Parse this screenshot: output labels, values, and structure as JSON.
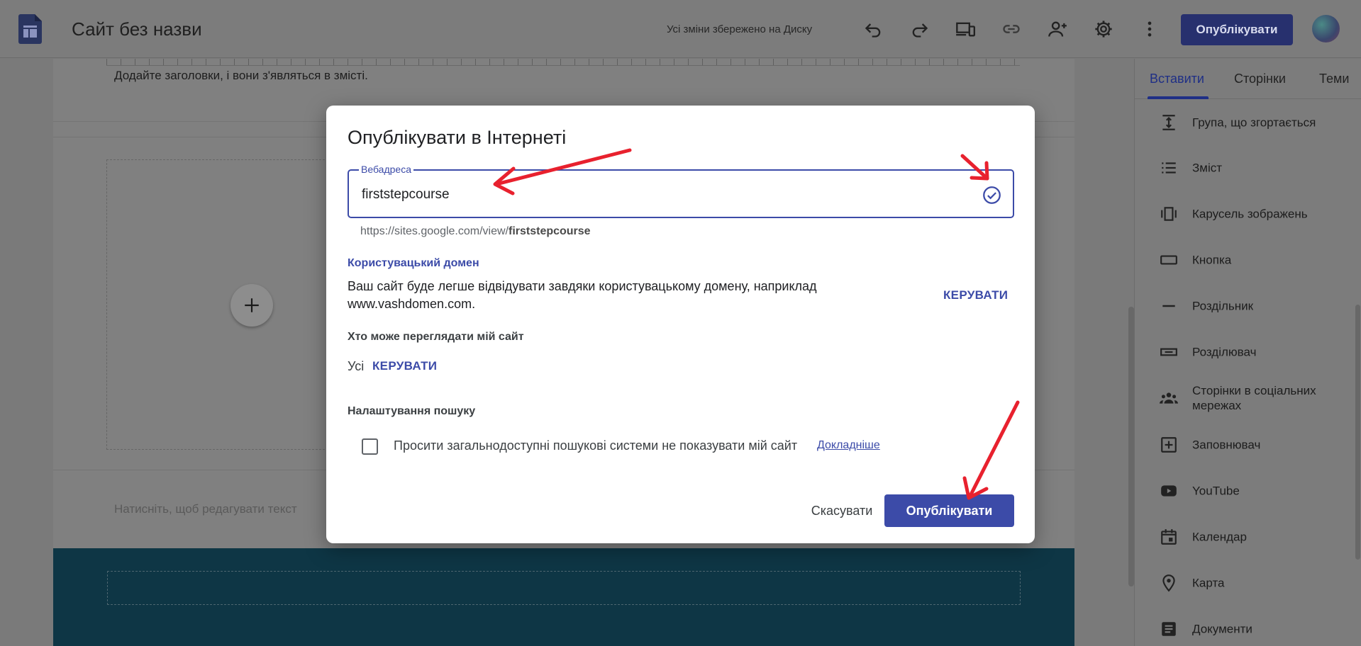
{
  "header": {
    "site_title": "Сайт без назви",
    "save_status": "Усі зміни збережено на Диску",
    "publish_label": "Опублікувати"
  },
  "editor": {
    "toc_hint": "Додайте заголовки, і вони з'являться в змісті.",
    "click_hint": "Натисніть, щоб редагувати текст"
  },
  "panel": {
    "tabs": [
      {
        "label": "Вставити",
        "active": true
      },
      {
        "label": "Сторінки",
        "active": false
      },
      {
        "label": "Теми",
        "active": false
      }
    ],
    "items": [
      {
        "label": "Група, що згортається",
        "icon": "collapsible-group-icon"
      },
      {
        "label": "Зміст",
        "icon": "table-of-contents-icon"
      },
      {
        "label": "Карусель зображень",
        "icon": "carousel-icon"
      },
      {
        "label": "Кнопка",
        "icon": "button-icon"
      },
      {
        "label": "Роздільник",
        "icon": "divider-icon"
      },
      {
        "label": "Розділювач",
        "icon": "spacer-icon"
      },
      {
        "label": "Сторінки в соціальних мережах",
        "icon": "social-links-icon"
      },
      {
        "label": "Заповнювач",
        "icon": "placeholder-icon"
      },
      {
        "label": "YouTube",
        "icon": "youtube-icon"
      },
      {
        "label": "Календар",
        "icon": "calendar-icon"
      },
      {
        "label": "Карта",
        "icon": "map-pin-icon"
      },
      {
        "label": "Документи",
        "icon": "docs-icon"
      }
    ]
  },
  "dialog": {
    "title": "Опублікувати в Інтернеті",
    "field_label": "Вебадреса",
    "field_value": "firststepcourse",
    "url_prefix": "https://sites.google.com/view/",
    "url_slug": "firststepcourse",
    "custom_domain_heading": "Користувацький домен",
    "custom_domain_desc": "Ваш сайт буде легше відвідувати завдяки користувацькому домену, наприклад www.vashdomen.com.",
    "manage_label": "КЕРУВАТИ",
    "viewers_heading": "Хто може переглядати мій сайт",
    "viewers_value": "Усі",
    "search_heading": "Налаштування пошуку",
    "search_checkbox_label": "Просити загальнодоступні пошукові системи не показувати мій сайт",
    "search_checkbox_checked": false,
    "learn_more": "Докладніше",
    "cancel_label": "Скасувати",
    "publish_label": "Опублікувати"
  },
  "colors": {
    "accent": "#3c4ba8",
    "annotation_arrow": "#e8212e",
    "footer_band": "#0e3645"
  }
}
